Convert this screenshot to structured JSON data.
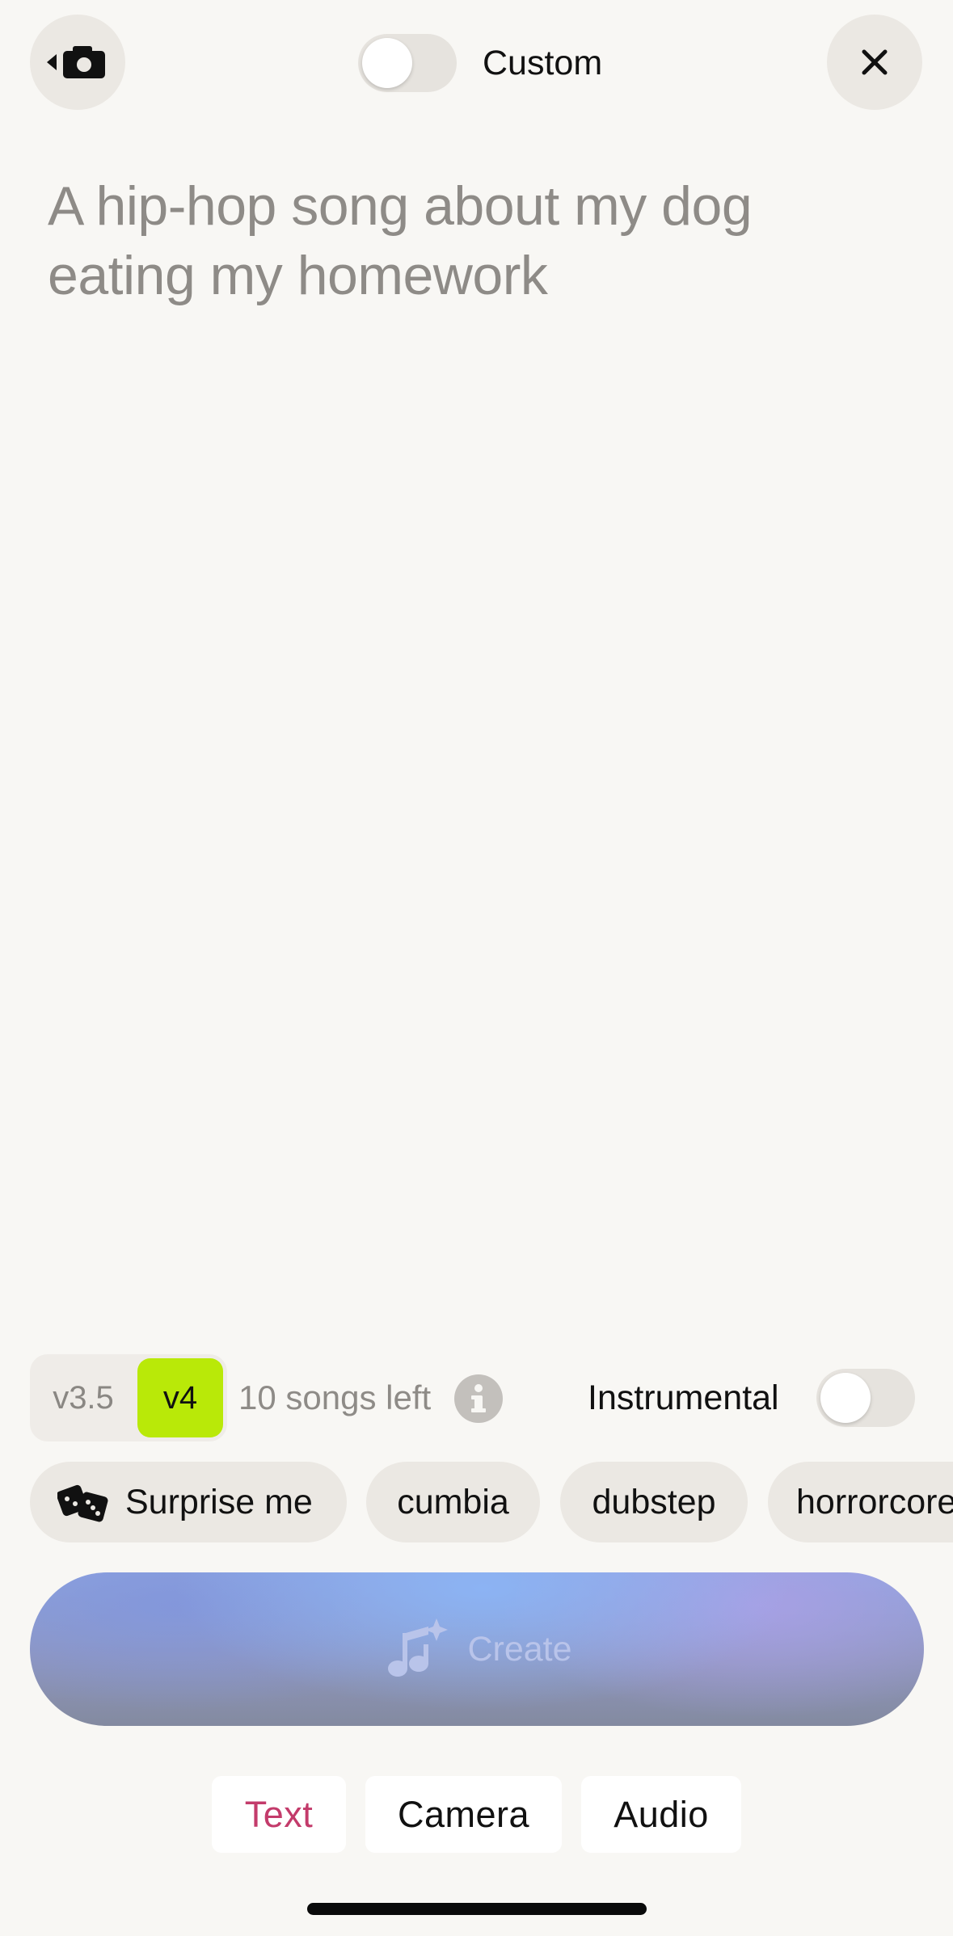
{
  "header": {
    "custom_label": "Custom",
    "custom_toggle_on": false,
    "back_icon": "back-camera-icon",
    "close_icon": "close-icon"
  },
  "prompt": {
    "placeholder": "A hip-hop song about my dog eating my homework"
  },
  "version": {
    "options": [
      "v3.5",
      "v4"
    ],
    "selected": "v4",
    "selected_color": "#b9e908",
    "songs_left": "10 songs left",
    "info_icon": "info-icon"
  },
  "instrumental": {
    "label": "Instrumental",
    "on": false
  },
  "chips": {
    "surprise_label": "Surprise me",
    "surprise_icon": "dice-icon",
    "tags": [
      "cumbia",
      "dubstep",
      "horrorcore"
    ]
  },
  "create": {
    "label": "Create",
    "icon": "music-sparkle-icon"
  },
  "tabs": {
    "items": [
      "Text",
      "Camera",
      "Audio"
    ],
    "active": "Text",
    "active_color": "#c33b6b"
  }
}
